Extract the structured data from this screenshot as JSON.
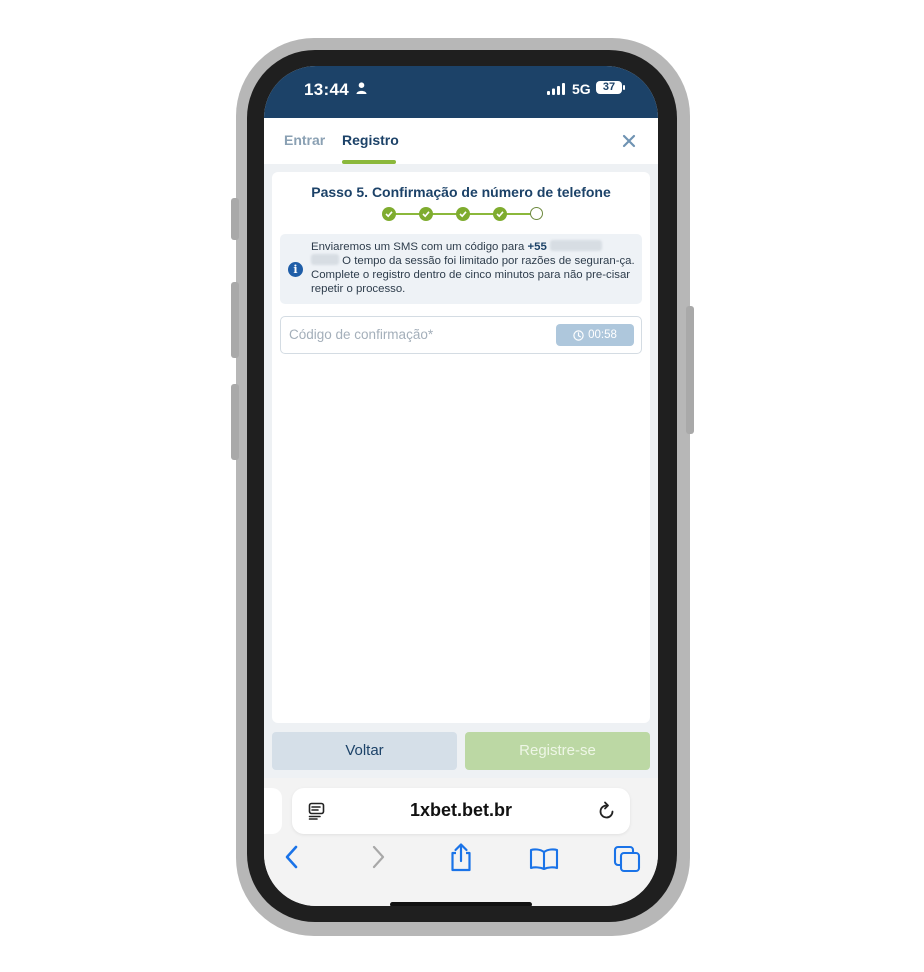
{
  "status_bar": {
    "time": "13:44",
    "network": "5G",
    "battery": "37",
    "icons": [
      "person-icon",
      "signal-icon",
      "battery-icon"
    ]
  },
  "tabs": [
    {
      "label": "Entrar",
      "active": false
    },
    {
      "label": "Registro",
      "active": true
    }
  ],
  "form": {
    "step_title": "Passo 5. Confirmação de número de telefone",
    "steps_total": 5,
    "steps_completed": 4,
    "info": {
      "text_before_phone": "Enviaremos um SMS com um código para ",
      "phone_prefix": "+55",
      "text_after_phone": " O tempo da sessão foi limitado por razões de seguran-ça. Complete o registro dentro de cinco minutos para não pre-cisar repetir o processo."
    },
    "code_field": {
      "placeholder": "Código de confirmação*",
      "value": "",
      "timer": "00:58"
    },
    "back_label": "Voltar",
    "register_label": "Registre-se"
  },
  "browser": {
    "url": "1xbet.bet.br",
    "icons": [
      "reader-icon",
      "reload-icon",
      "back-arrow-icon",
      "forward-arrow-icon",
      "share-icon",
      "bookmarks-icon",
      "tabs-icon"
    ]
  },
  "colors": {
    "header": "#1c4268",
    "accent_green": "#8bb83b",
    "primary_text": "#1c4268"
  }
}
